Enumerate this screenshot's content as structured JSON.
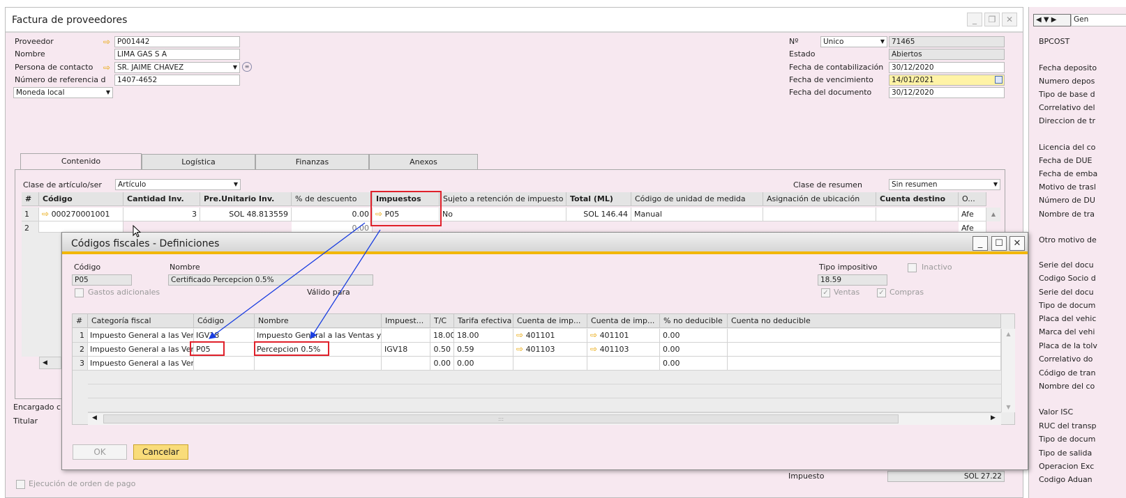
{
  "window": {
    "title": "Factura de proveedores"
  },
  "header_left": {
    "proveedor_label": "Proveedor",
    "proveedor_value": "P001442",
    "nombre_label": "Nombre",
    "nombre_value": "LIMA GAS S A",
    "contacto_label": "Persona de contacto",
    "contacto_value": "SR. JAIME CHAVEZ",
    "referencia_label": "Número de referencia d",
    "referencia_value": "1407-4652",
    "moneda_value": "Moneda local"
  },
  "header_right": {
    "no_label": "Nº",
    "serie_value": "Unico",
    "no_value": "71465",
    "estado_label": "Estado",
    "estado_value": "Abiertos",
    "contab_label": "Fecha de contabilización",
    "contab_value": "30/12/2020",
    "venc_label": "Fecha de vencimiento",
    "venc_value": "14/01/2021",
    "doc_label": "Fecha del documento",
    "doc_value": "30/12/2020"
  },
  "tabs": [
    "Contenido",
    "Logística",
    "Finanzas",
    "Anexos"
  ],
  "content": {
    "clase_articulo_label": "Clase de artículo/ser",
    "clase_articulo_value": "Artículo",
    "clase_resumen_label": "Clase de resumen",
    "clase_resumen_value": "Sin resumen",
    "columns": [
      "#",
      "Código",
      "Cantidad Inv.",
      "Pre.Unitario Inv.",
      "% de descuento",
      "Impuestos",
      "Sujeto a retención de impuesto",
      "Total (ML)",
      "Código de unidad de medida",
      "Asignación de ubicación",
      "Cuenta destino",
      "O..."
    ],
    "row1": {
      "num": "1",
      "codigo": "000270001001",
      "cantidad": "3",
      "precio": "SOL 48.813559",
      "descuento": "0.00",
      "impuesto": "P05",
      "sujeto": "No",
      "total": "SOL 146.44",
      "unidad": "Manual",
      "o": "Afe"
    },
    "row2": {
      "num": "2",
      "descuento": "0.00",
      "o": "Afe"
    }
  },
  "bottom_left": {
    "encargado_label": "Encargado c",
    "titular_label": "Titular",
    "ejecucion_label": "Ejecución de orden de pago"
  },
  "bottom_right": {
    "impuesto_label": "Impuesto",
    "impuesto_value": "SOL 27.22"
  },
  "right_panel": {
    "selector_value": "Gen",
    "labels": [
      "BPCOST",
      "Fecha deposito",
      "Numero depos",
      "Tipo de base d",
      "Correlativo del",
      "Direccion de tr",
      "Licencia del co",
      "Fecha de DUE",
      "Fecha de emba",
      "Motivo de trasl",
      "Número de DU",
      "Nombre de tra",
      "Otro motivo de",
      "Serie del docu",
      "Codigo Socio d",
      "Serie del docu",
      "Tipo de docum",
      "Placa del vehic",
      "Marca del vehi",
      "Placa de la tolv",
      "Correlativo do",
      "Código de tran",
      "Nombre del co",
      "Valor ISC",
      "RUC del transp",
      "Tipo de docum",
      "Tipo de salida",
      "Operacion Exc",
      "Codigo Aduan"
    ]
  },
  "dialog": {
    "title": "Códigos fiscales - Definiciones",
    "codigo_label": "Código",
    "codigo_value": "P05",
    "nombre_label": "Nombre",
    "nombre_value": "Certificado Percepcion 0.5%",
    "tipo_label": "Tipo impositivo",
    "tipo_value": "18.59",
    "inactivo_label": "Inactivo",
    "gastos_label": "Gastos adicionales",
    "valido_label": "Válido para",
    "ventas_label": "Ventas",
    "compras_label": "Compras",
    "columns": [
      "#",
      "Categoría fiscal",
      "Código",
      "Nombre",
      "Impuest...",
      "T/C",
      "Tarifa efectiva",
      "Cuenta de imp...",
      "Cuenta de imp...",
      "% no deducible",
      "Cuenta no deducible"
    ],
    "rows": [
      {
        "num": "1",
        "categoria": "Impuesto General a las Ven",
        "codigo": "IGV18",
        "nombre": "Impuesto General a las Ventas y (",
        "impuesto": "",
        "tc": "18.00",
        "tarifa": "18.00",
        "cuenta1": "401101",
        "cuenta2": "401101",
        "no_deducible": "0.00"
      },
      {
        "num": "2",
        "categoria": "Impuesto General a las Ven",
        "codigo": "P05",
        "nombre": "Percepcion 0.5%",
        "impuesto": "IGV18",
        "tc": "0.50",
        "tarifa": "0.59",
        "cuenta1": "401103",
        "cuenta2": "401103",
        "no_deducible": "0.00"
      },
      {
        "num": "3",
        "categoria": "Impuesto General a las Ven",
        "codigo": "",
        "nombre": "",
        "impuesto": "",
        "tc": "0.00",
        "tarifa": "0.00",
        "cuenta1": "",
        "cuenta2": "",
        "no_deducible": "0.00"
      }
    ],
    "ok_label": "OK",
    "cancel_label": "Cancelar"
  },
  "colors": {
    "accent": "#f2b705",
    "annotation": "#e0202a",
    "arrow": "#1a3ee0",
    "background": "#f7e8f0"
  }
}
